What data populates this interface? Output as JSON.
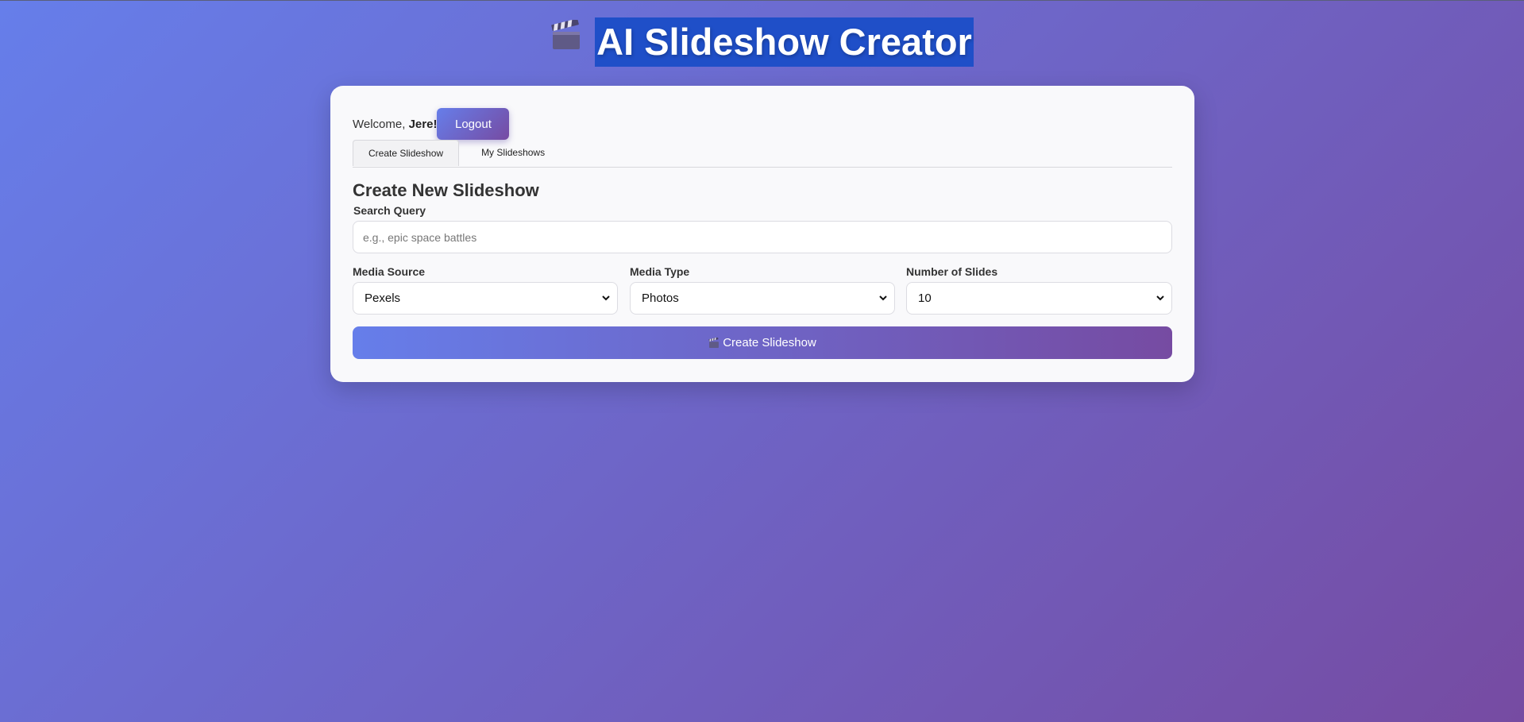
{
  "header": {
    "icon": "clapperboard-icon",
    "title": "AI Slideshow Creator"
  },
  "user": {
    "welcome_prefix": "Welcome, ",
    "username": "Jere!",
    "logout_label": "Logout"
  },
  "tabs": [
    {
      "label": "Create Slideshow",
      "active": true
    },
    {
      "label": "My Slideshows",
      "active": false
    }
  ],
  "form": {
    "title": "Create New Slideshow",
    "search_label": "Search Query",
    "search_placeholder": "e.g., epic space battles",
    "search_value": "",
    "media_source_label": "Media Source",
    "media_source_value": "Pexels",
    "media_type_label": "Media Type",
    "media_type_value": "Photos",
    "num_slides_label": "Number of Slides",
    "num_slides_value": "10",
    "submit_icon": "clapperboard-icon",
    "submit_label": "Create Slideshow"
  },
  "colors": {
    "gradient_start": "#667eea",
    "gradient_end": "#764ba2",
    "title_highlight": "#1f4fc8",
    "card_bg": "#f9f9fb"
  }
}
